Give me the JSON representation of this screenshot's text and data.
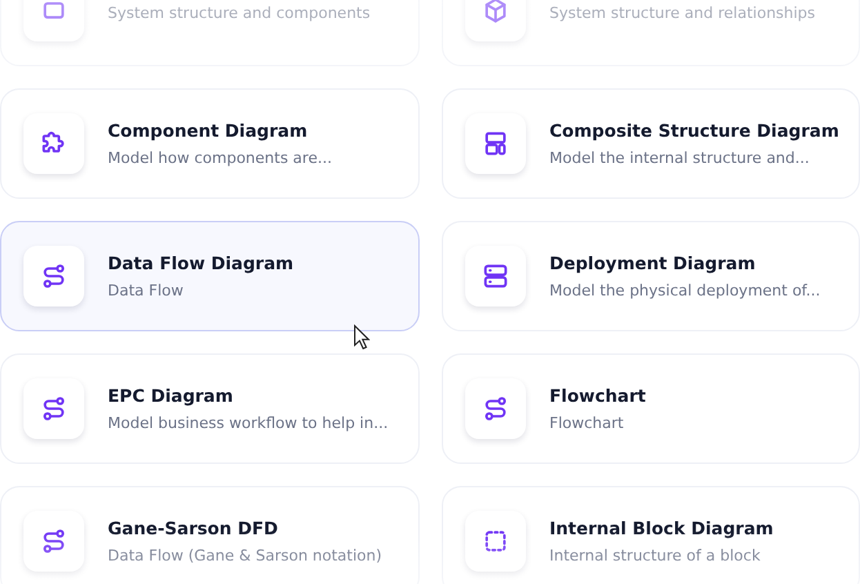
{
  "cards": [
    {
      "kind": "box",
      "description": "System structure and components",
      "hovered": false
    },
    {
      "kind": "cube",
      "description": "System structure and relationships",
      "hovered": false
    },
    {
      "kind": "puzzle",
      "title": "Component Diagram",
      "description": "Model how components are...",
      "hovered": false
    },
    {
      "kind": "layout",
      "title": "Composite Structure Diagram",
      "description": "Model the internal structure and...",
      "hovered": false
    },
    {
      "kind": "flow",
      "title": "Data Flow Diagram",
      "description": "Data Flow",
      "hovered": true
    },
    {
      "kind": "server",
      "title": "Deployment Diagram",
      "description": "Model the physical deployment of...",
      "hovered": false
    },
    {
      "kind": "flow",
      "title": "EPC Diagram",
      "description": "Model business workflow to help in...",
      "hovered": false
    },
    {
      "kind": "flow",
      "title": "Flowchart",
      "description": "Flowchart",
      "hovered": false
    },
    {
      "kind": "flow",
      "title": "Gane-Sarson DFD",
      "description": "Data Flow (Gane & Sarson notation)",
      "hovered": false
    },
    {
      "kind": "dashed-square",
      "title": "Internal Block Diagram",
      "description": "Internal structure of a block",
      "hovered": false
    }
  ]
}
